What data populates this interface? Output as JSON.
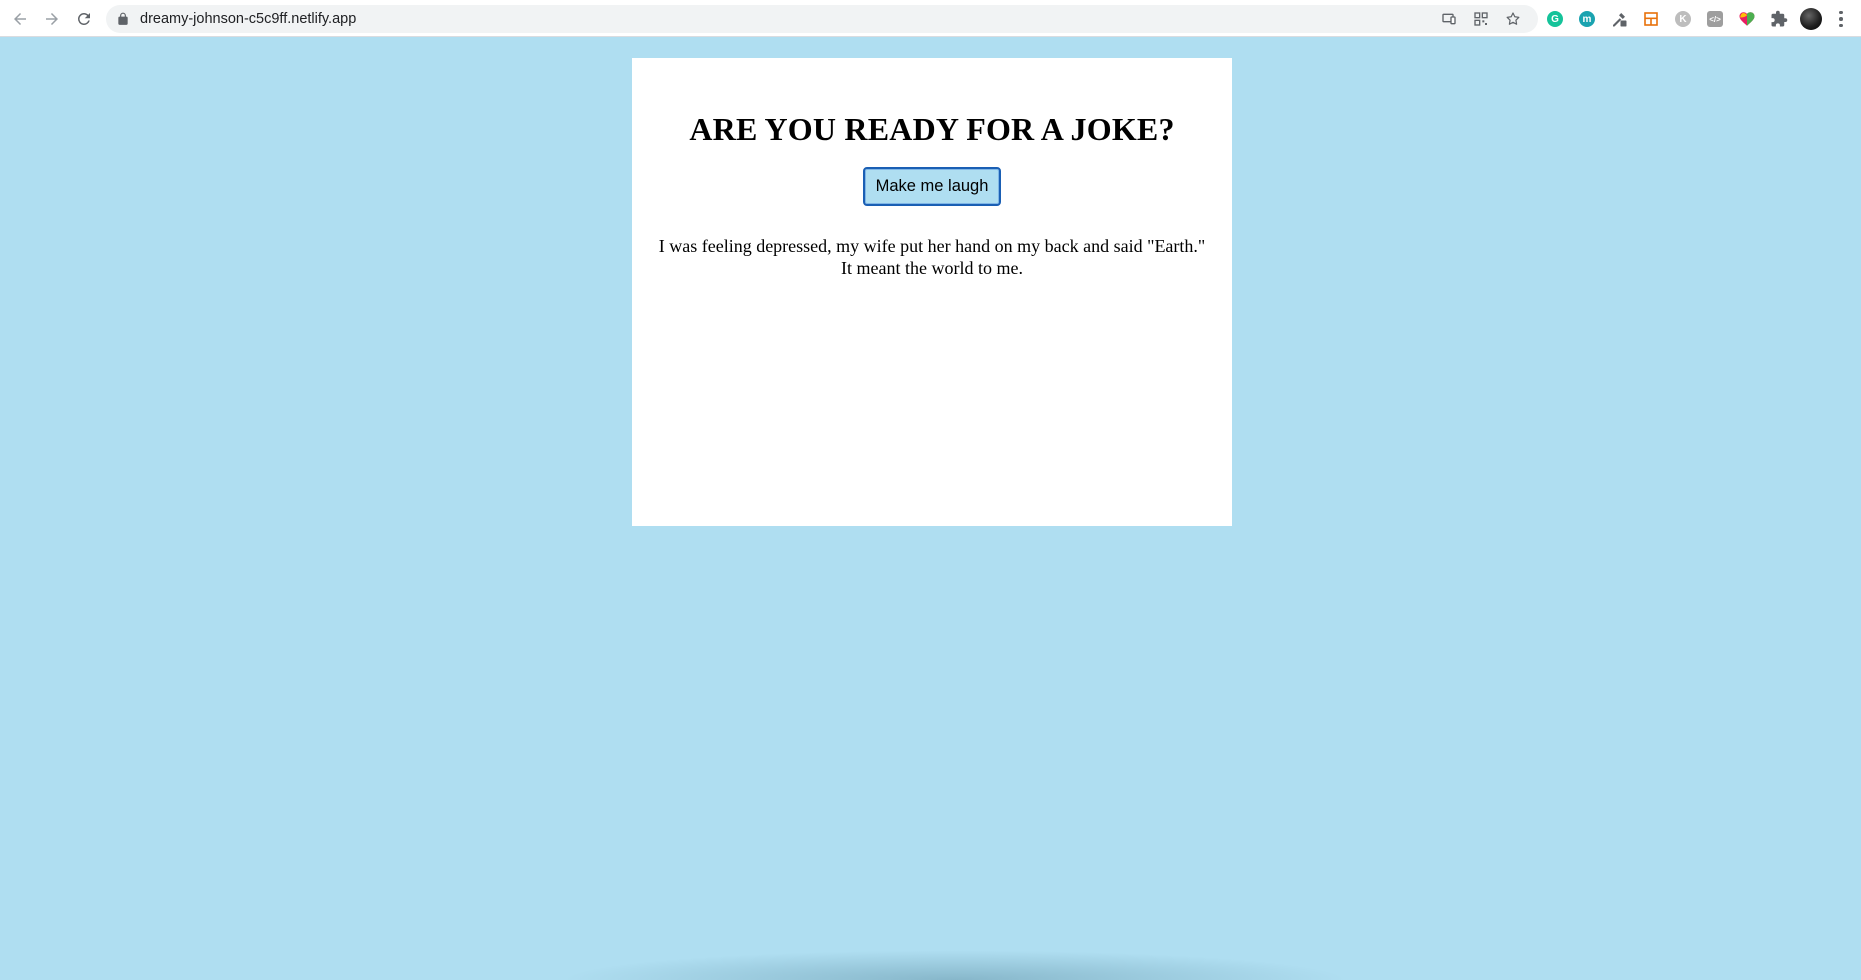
{
  "browser": {
    "url": "dreamy-johnson-c5c9ff.netlify.app",
    "nav": {
      "back_icon": "arrow-left-icon",
      "forward_icon": "arrow-right-icon",
      "reload_icon": "reload-icon"
    },
    "omnibox_icons": [
      "cast-icon",
      "qr-code-icon",
      "star-icon"
    ],
    "extensions": [
      {
        "name": "grammarly-extension-icon",
        "glyph": "G",
        "color": "#15c39a"
      },
      {
        "name": "m-extension-icon",
        "glyph": "m",
        "color": "#1aa3b0"
      },
      {
        "name": "eyedropper-extension-icon",
        "glyph": "",
        "color": "#5f6368"
      },
      {
        "name": "layout-extension-icon",
        "glyph": "",
        "color": "#e8710a"
      },
      {
        "name": "k-extension-icon",
        "glyph": "K",
        "color": "#bdbdbd"
      },
      {
        "name": "code-extension-icon",
        "glyph": "</>",
        "color": "#9e9e9e"
      },
      {
        "name": "heart-extension-icon",
        "glyph": "",
        "color": "#e91e63"
      },
      {
        "name": "puzzle-extensions-icon",
        "glyph": "",
        "color": "#5f6368"
      }
    ]
  },
  "page": {
    "background_color": "#afdef1",
    "heading": "ARE YOU READY FOR A JOKE?",
    "button_label": "Make me laugh",
    "joke_line_1": "I was feeling depressed, my wife put her hand on my back and said \"Earth.\"",
    "joke_line_2": "It meant the world to me."
  }
}
